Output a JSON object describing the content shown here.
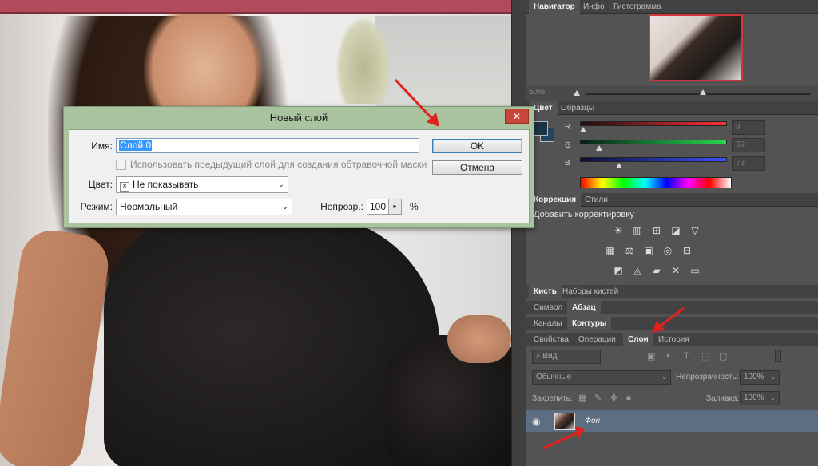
{
  "dialog": {
    "title": "Новый слой",
    "close": "✕",
    "name_label": "Имя:",
    "name_value": "Слой 0",
    "checkbox_label": "Использовать предыдущий слой для создания обтравочной маски",
    "color_label": "Цвет:",
    "color_value": "Не показывать",
    "mode_label": "Режим:",
    "mode_value": "Нормальный",
    "opacity_label": "Непрозр.:",
    "opacity_value": "100",
    "opacity_unit": "%",
    "ok": "OK",
    "cancel": "Отмена"
  },
  "navigator": {
    "tabs": [
      "Навигатор",
      "Инфо",
      "Гистограмма"
    ],
    "zoom": "50%"
  },
  "color_panel": {
    "tabs": [
      "Цвет",
      "Образцы"
    ],
    "channels": [
      {
        "label": "R",
        "value": "9",
        "color_from": "#1c0f0f",
        "color_to": "#ff2f3a"
      },
      {
        "label": "G",
        "value": "39",
        "color_from": "#0a1f18",
        "color_to": "#26d84f"
      },
      {
        "label": "B",
        "value": "73",
        "color_from": "#0b1030",
        "color_to": "#3a52ff"
      }
    ],
    "foreground": "#1c3346"
  },
  "adjustments": {
    "tabs": [
      "Коррекция",
      "Стили"
    ],
    "title": "Добавить корректировку",
    "row1": [
      "☀",
      "▥",
      "⊞",
      "◪",
      "▽"
    ],
    "row2": [
      "▦",
      "⚖",
      "▣",
      "◎",
      "⊟"
    ],
    "row3": [
      "◩",
      "◬",
      "▰",
      "✕",
      "▭"
    ]
  },
  "panel_tabs": {
    "brush": [
      "Кисть",
      "Наборы кистей"
    ],
    "character": [
      "Символ",
      "Абзац"
    ],
    "channels": [
      "Каналы",
      "Контуры"
    ],
    "layers": [
      "Свойства",
      "Операции",
      "Слои",
      "История"
    ]
  },
  "layers": {
    "filter_placeholder": "Вид",
    "blend_mode": "Обычные",
    "opacity_label": "Непрозрачность:",
    "opacity_value": "100%",
    "lock_label": "Закрепить:",
    "fill_label": "Заливка:",
    "fill_value": "100%",
    "layer_name": "Фон"
  }
}
